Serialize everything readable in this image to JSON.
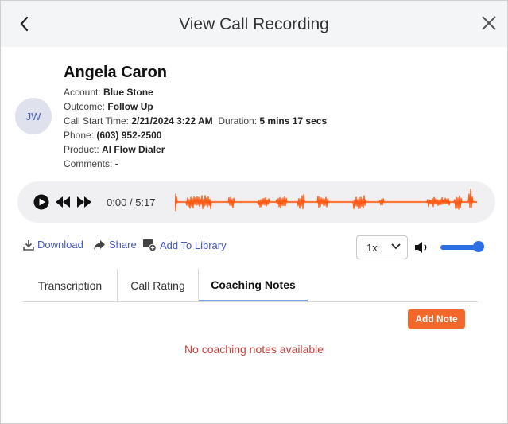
{
  "header": {
    "title": "View Call Recording"
  },
  "contact": {
    "initials": "JW",
    "name": "Angela Caron",
    "account_label": "Account:",
    "account": "Blue Stone",
    "outcome_label": "Outcome:",
    "outcome": "Follow Up",
    "start_label": "Call Start Time:",
    "start": "2/21/2024 3:22 AM",
    "duration_label": "Duration:",
    "duration": "5 mins 17 secs",
    "phone_label": "Phone:",
    "phone": "(603) 952-2500",
    "product_label": "Product:",
    "product": "AI Flow Dialer",
    "comments_label": "Comments:",
    "comments": "-"
  },
  "player": {
    "current": "0:00",
    "sep": "/",
    "total": "5:17",
    "wave_color": "#ff5a14"
  },
  "actions": {
    "download": "Download",
    "share": "Share",
    "library": "Add To Library"
  },
  "speed": {
    "value": "1x"
  },
  "volume": {
    "level": 1.0
  },
  "tabs": [
    "Transcription",
    "Call Rating",
    "Coaching Notes"
  ],
  "active_tab": "Coaching Notes",
  "notes": {
    "add_label": "Add Note",
    "empty_text": "No coaching notes available"
  }
}
